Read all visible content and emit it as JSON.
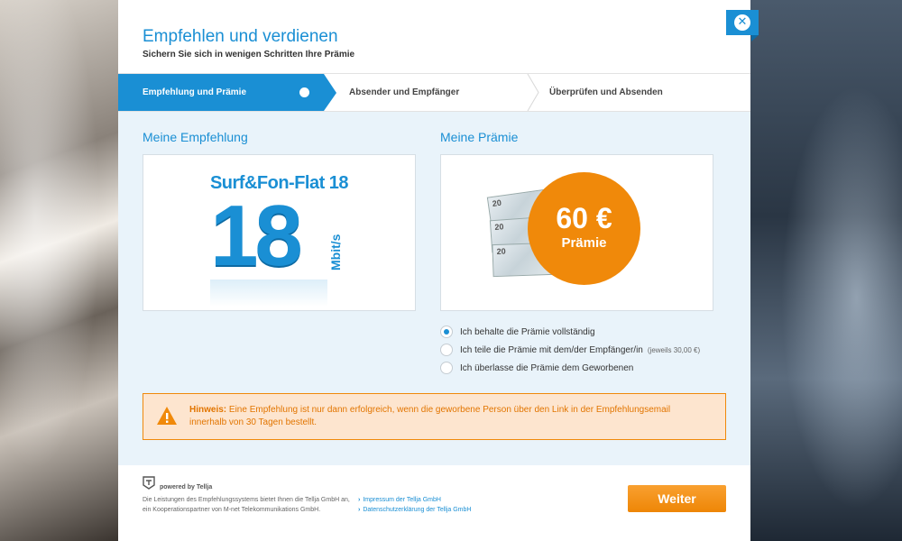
{
  "dialog": {
    "title": "Empfehlen und verdienen",
    "subtitle": "Sichern Sie sich in wenigen Schritten Ihre Prämie",
    "close_icon_glyph": "✕"
  },
  "steps": [
    {
      "label": "Empfehlung und Prämie",
      "active": true
    },
    {
      "label": "Absender und Empfänger",
      "active": false
    },
    {
      "label": "Überprüfen und Absenden",
      "active": false
    }
  ],
  "recommendation": {
    "title": "Meine Empfehlung",
    "tariff_name": "Surf&Fon-Flat 18",
    "speed": "18",
    "unit": "Mbit/s"
  },
  "reward": {
    "title": "Meine Prämie",
    "bill_value": "20",
    "bill_currency": "EURO",
    "amount": "60 €",
    "label": "Prämie"
  },
  "options": [
    {
      "label": "Ich behalte die Prämie vollständig",
      "note": "",
      "checked": true
    },
    {
      "label": "Ich teile die Prämie mit dem/der Empfänger/in",
      "note": "(jeweils 30,00 €)",
      "checked": false
    },
    {
      "label": "Ich überlasse die Prämie dem Geworbenen",
      "note": "",
      "checked": false
    }
  ],
  "hint": {
    "label": "Hinweis:",
    "text": "Eine Empfehlung ist nur dann erfolgreich, wenn die geworbene Person über den Link in der Empfehlungsemail innerhalb von 30 Tagen bestellt."
  },
  "footer": {
    "powered_by": "powered by Tellja",
    "description": "Die Leistungen des Empfehlungssystems bietet Ihnen die Tellja GmbH an, ein Kooperationspartner von M-net Telekommunikations GmbH.",
    "links": [
      "Impressum der Tellja GmbH",
      "Datenschutzerklärung der Tellja GmbH"
    ],
    "next_button": "Weiter"
  },
  "colors": {
    "accent": "#1a8fd4",
    "orange": "#f0890a",
    "content_bg": "#e9f3fa"
  }
}
